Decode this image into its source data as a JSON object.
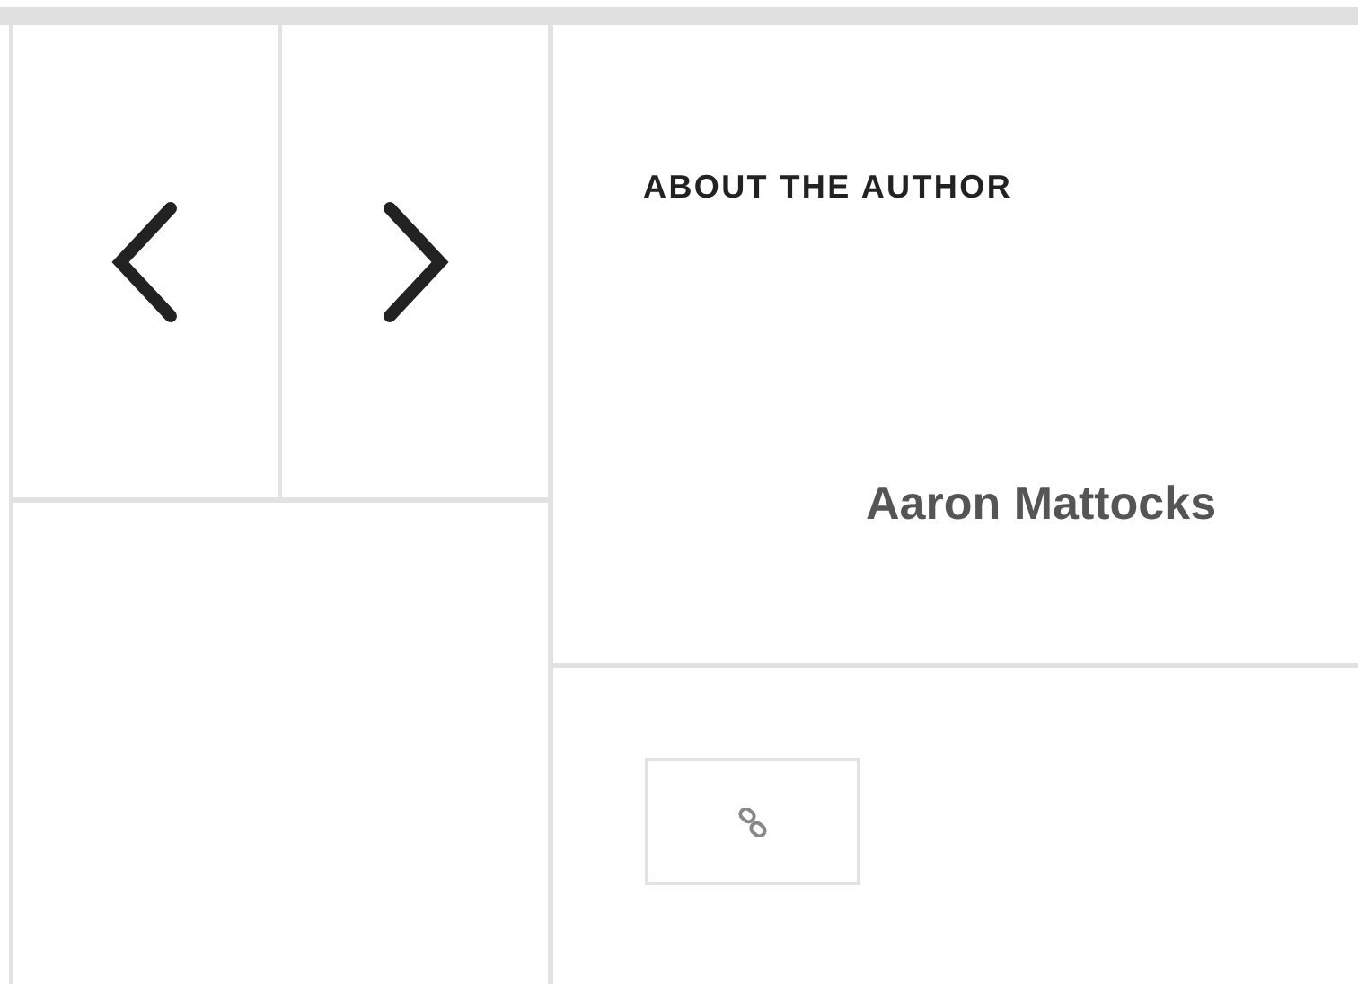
{
  "heading": "ABOUT THE AUTHOR",
  "author": {
    "name": "Aaron Mattocks"
  }
}
